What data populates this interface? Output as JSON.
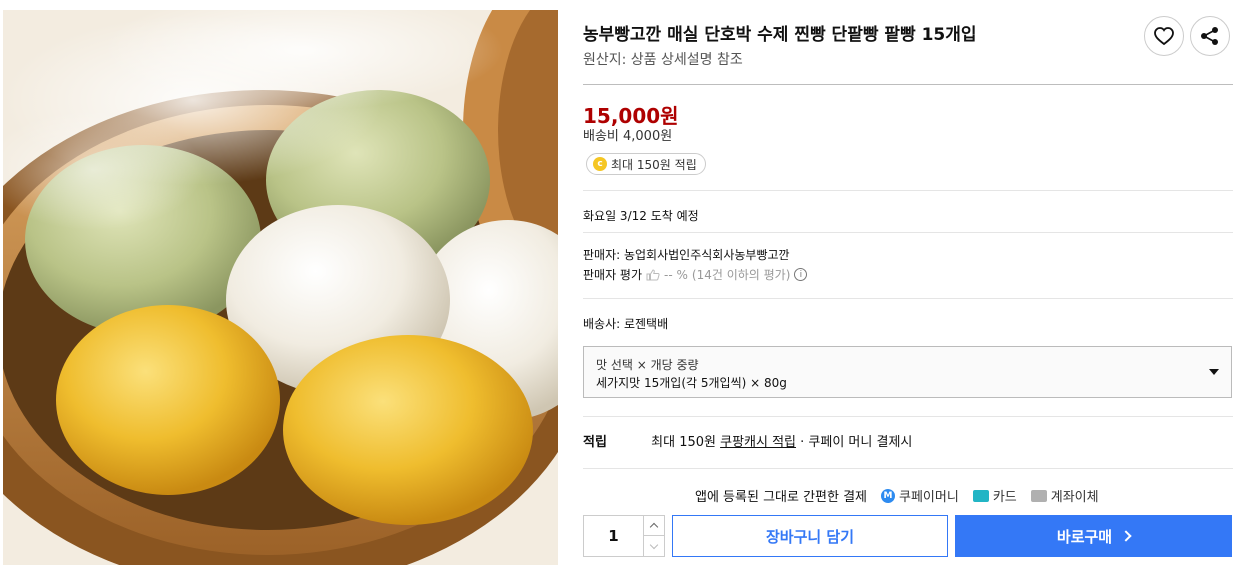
{
  "product": {
    "title": "농부빵고깐 매실 단호박 수제 찐빵 단팥빵 팥빵 15개입",
    "origin": "원산지: 상품 상세설명 참조",
    "image_alt": "찐빵 제품 사진"
  },
  "actions": {
    "wishlist_icon": "heart-icon",
    "share_icon": "share-icon"
  },
  "pricing": {
    "price": "15,000원",
    "shipping_fee": "배송비 4,000원",
    "reward_chip": "최대 150원 적립",
    "coin_symbol": "c"
  },
  "delivery": {
    "arrival": "화요일 3/12 도착 예정",
    "carrier": "배송사: 로젠택배"
  },
  "seller": {
    "name": "판매자: 농업회사법인주식회사농부빵고깐",
    "rating_label": "판매자 평가",
    "rating_value": "-- %",
    "rating_note": "(14건 이하의 평가)",
    "info_symbol": "i"
  },
  "option": {
    "label": "맛 선택 × 개당 중량",
    "value": "세가지맛 15개입(각 5개입씩) × 80g"
  },
  "reward_row": {
    "label": "적립",
    "prefix": "최대 150원",
    "link": "쿠팡캐시 적립",
    "suffix": "· 쿠페이 머니 결제시"
  },
  "payment": {
    "intro": "앱에 등록된 그대로 간편한 결제",
    "coupay_symbol": "M",
    "coupay_money": "쿠페이머니",
    "card": "카드",
    "bank": "계좌이체"
  },
  "purchase": {
    "quantity": "1",
    "cart_label": "장바구니 담기",
    "buy_label": "바로구매"
  },
  "colors": {
    "price_red": "#ae0000",
    "accent_blue": "#3478f6",
    "coin_yellow": "#f5c623"
  }
}
